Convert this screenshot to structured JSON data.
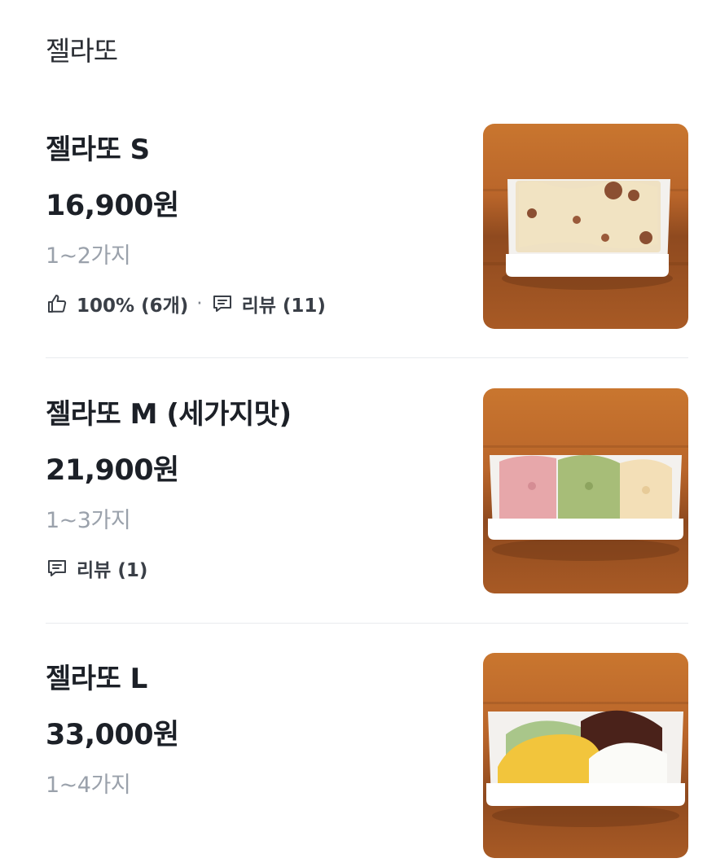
{
  "section": {
    "title": "젤라또"
  },
  "items": [
    {
      "name": "젤라또 S",
      "price": "16,900원",
      "desc": "1~2가지",
      "like_text": "100% (6개)",
      "separator": "·",
      "review_text": "리뷰 (11)",
      "image_icon": "gelato-small-photo"
    },
    {
      "name": "젤라또 M (세가지맛)",
      "price": "21,900원",
      "desc": "1~3가지",
      "review_text": "리뷰 (1)",
      "image_icon": "gelato-medium-photo"
    },
    {
      "name": "젤라또 L",
      "price": "33,000원",
      "desc": "1~4가지",
      "image_icon": "gelato-large-photo"
    }
  ],
  "colors": {
    "text_primary": "#1c2027",
    "text_secondary": "#9aa1ab",
    "divider": "#e9ebee",
    "wood": "#b5672e"
  }
}
